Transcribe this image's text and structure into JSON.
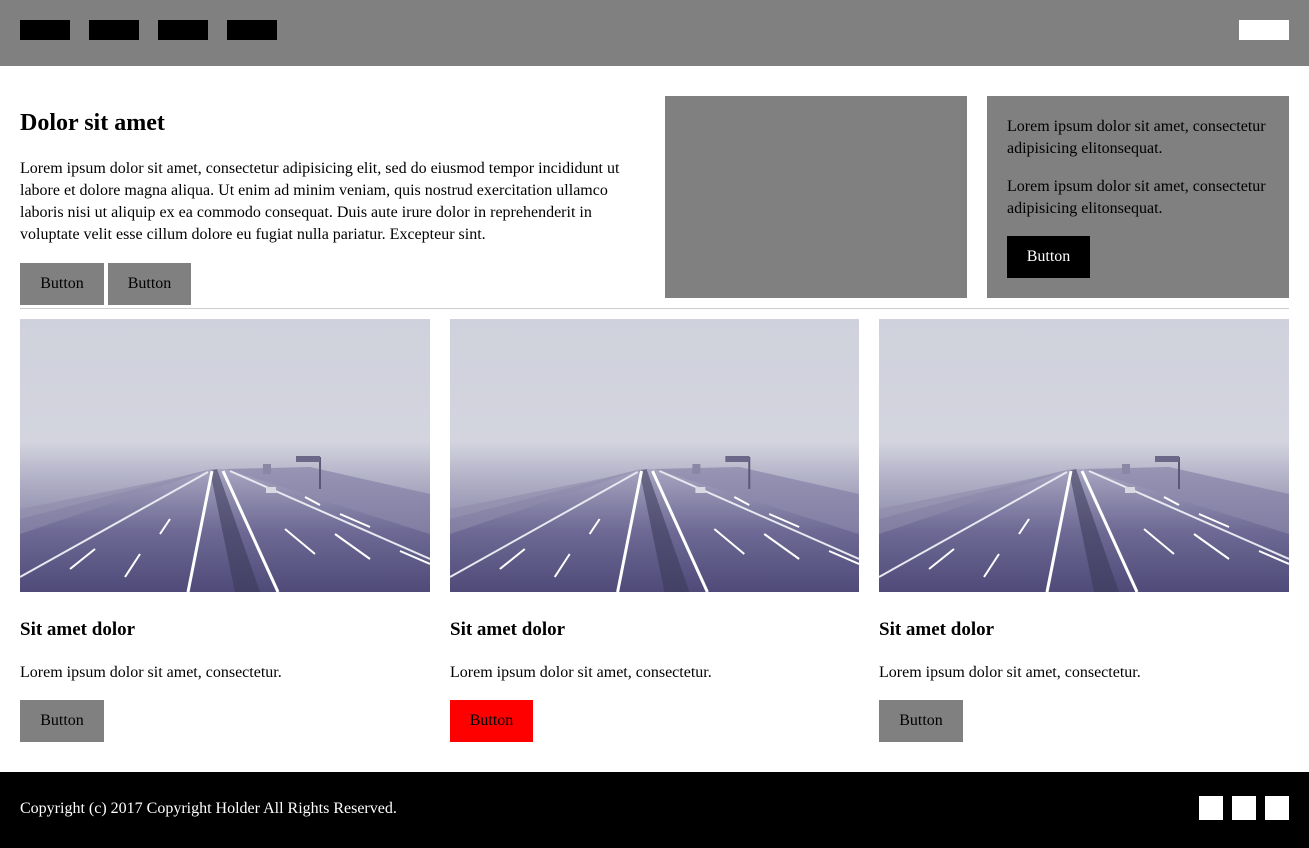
{
  "hero": {
    "title": "Dolor sit amet",
    "text": "Lorem ipsum dolor sit amet, consectetur adipisicing elit, sed do eiusmod tempor incididunt ut labore et dolore magna aliqua. Ut enim ad minim veniam, quis nostrud exercitation ullamco laboris nisi ut aliquip ex ea commodo consequat. Duis aute irure dolor in reprehenderit in voluptate velit esse cillum dolore eu fugiat nulla pariatur. Excepteur sint.",
    "button1_label": "Button",
    "button2_label": "Button"
  },
  "info_box": {
    "paragraph1": "Lorem ipsum dolor sit amet, consectetur adipisicing elitonsequat.",
    "paragraph2": "Lorem ipsum dolor sit amet, consectetur adipisicing elitonsequat.",
    "button_label": "Button"
  },
  "cards": [
    {
      "title": "Sit amet dolor",
      "text": "Lorem ipsum dolor sit amet, consectetur.",
      "button_label": "Button",
      "button_color": "#808080"
    },
    {
      "title": "Sit amet dolor",
      "text": "Lorem ipsum dolor sit amet, consectetur.",
      "button_label": "Button",
      "button_color": "#ff0000"
    },
    {
      "title": "Sit amet dolor",
      "text": "Lorem ipsum dolor sit amet, consectetur.",
      "button_label": "Button",
      "button_color": "#808080"
    }
  ],
  "footer": {
    "copyright": "Copyright (c) 2017 Copyright Holder All Rights Reserved."
  },
  "colors": {
    "header_bg": "#808080",
    "placeholder_grey": "#808080",
    "accent_red": "#ff0000",
    "footer_bg": "#000000"
  },
  "images": {
    "card_image": "foggy-highway-photo"
  }
}
